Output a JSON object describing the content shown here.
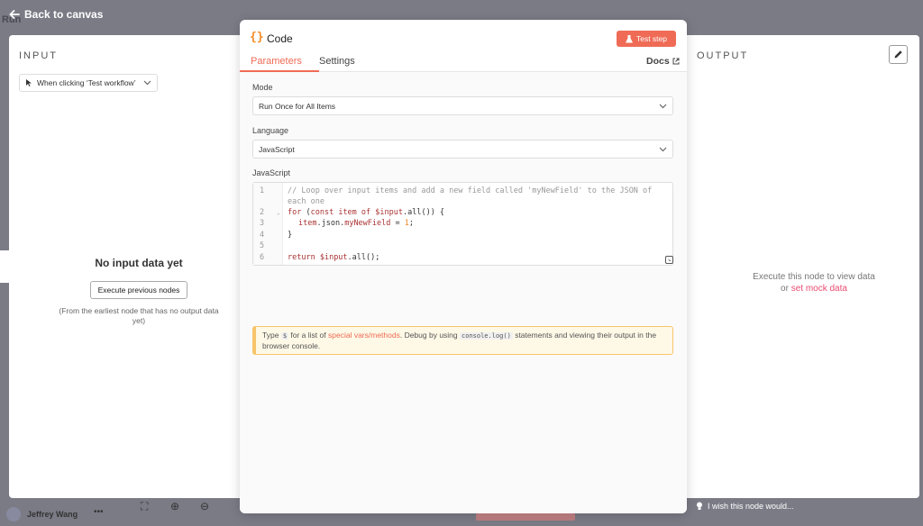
{
  "nav": {
    "back_label": "Back to canvas",
    "ghost_run": "Run"
  },
  "input_panel": {
    "title": "INPUT",
    "node_select": "When clicking ‘Test workflow’",
    "empty_title": "No input data yet",
    "execute_button": "Execute previous nodes",
    "hint": "(From the earliest node that has no output data yet)"
  },
  "output_panel": {
    "title": "OUTPUT",
    "empty_text": "Execute this node to view data",
    "or": "or",
    "mock_link": "set mock data"
  },
  "node": {
    "icon": "{}",
    "title": "Code",
    "test_button": "Test step",
    "tabs": [
      {
        "label": "Parameters"
      },
      {
        "label": "Settings"
      }
    ],
    "docs": "Docs"
  },
  "params": {
    "mode_label": "Mode",
    "mode_value": "Run Once for All Items",
    "language_label": "Language",
    "language_value": "JavaScript",
    "code_label": "JavaScript",
    "line_numbers": [
      "1",
      "2",
      "3",
      "4",
      "5",
      "6"
    ],
    "code": {
      "l1a": "// Loop over input items and add a new field called 'myNewField' to the JSON of",
      "l1b": "each one",
      "l2_kw": "for",
      "l2_rest1": " (",
      "l2_const": "const",
      "l2_item": " item",
      "l2_of": " of",
      "l2_input": " $input",
      "l2_end": ".all()) {",
      "l3_item": "item",
      "l3_mid": ".json.",
      "l3_prop": "myNewField",
      "l3_eq": " = ",
      "l3_num": "1",
      "l3_end": ";",
      "l4": "}",
      "l6_ret": "return",
      "l6_input": " $input",
      "l6_end": ".all();"
    },
    "hint_parts": {
      "p1": "Type",
      "dollar": "$",
      "p2": "for a list of",
      "link": "special vars/methods",
      "p3": ". Debug by using",
      "code": "console.log()",
      "p4": "statements and viewing their output in the browser console."
    }
  },
  "footer": {
    "username": "Jeffrey Wang",
    "dots": "•••",
    "wish": "I wish this node would..."
  },
  "colors": {
    "accent": "#ef6b56",
    "brand_orange": "#f28b26",
    "link": "#ea4b71"
  }
}
